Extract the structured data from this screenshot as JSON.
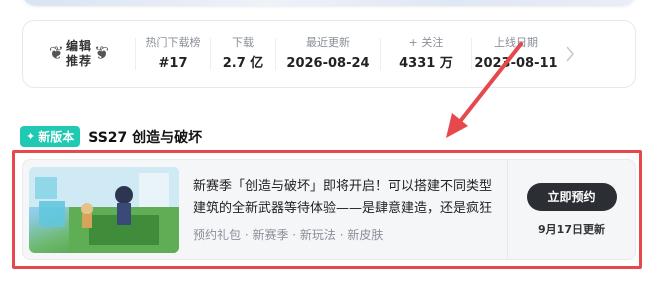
{
  "badge": {
    "line1": "编辑",
    "line2": "推荐"
  },
  "stats": [
    {
      "label": "热门下载榜",
      "value": "#17"
    },
    {
      "label": "下载",
      "value": "2.7 亿"
    },
    {
      "label": "最近更新",
      "value": "2026-08-24"
    },
    {
      "label": "+ 关注",
      "value": "4331 万"
    },
    {
      "label": "上线日期",
      "value": "2023-08-11"
    }
  ],
  "section": {
    "tag": "新版本",
    "title": "SS27 创造与破坏"
  },
  "event": {
    "description": "新赛季「创造与破坏」即将开启！可以搭建不同类型建筑的全新武器等待体验——是肆意建造，还是疯狂破坏",
    "tags": "预约礼包 · 新赛季 · 新玩法 · 新皮肤",
    "button_label": "立即预约",
    "update_note": "9月17日更新"
  },
  "icons": {
    "laurel": "laurel-icon",
    "chevron": "chevron-right-icon",
    "spark": "sparkle-icon"
  },
  "colors": {
    "new_tag": "#1fc9b2",
    "highlight": "#e5484d",
    "button": "#2b2e33"
  }
}
